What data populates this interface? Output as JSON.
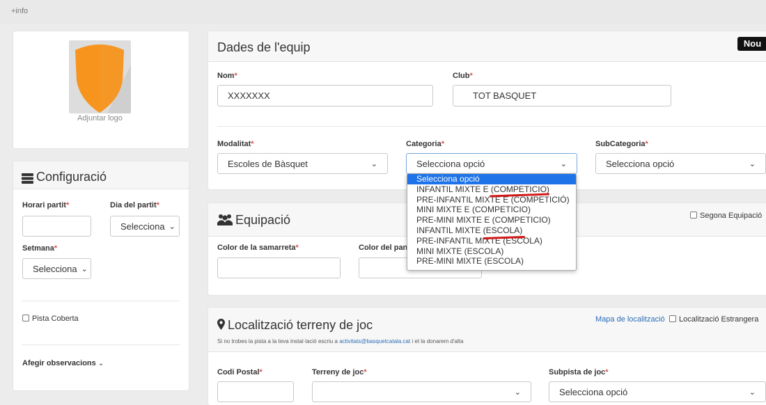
{
  "top": {
    "info_link": "+info"
  },
  "logo_card": {
    "upload_label": "Adjuntar logo"
  },
  "config": {
    "title": "Configuració",
    "horari_label": "Horari partit",
    "dia_label": "Dia del partit",
    "dia_select": "Selecciona",
    "setmana_label": "Setmana",
    "setmana_select": "Selecciona",
    "pista_coberta": "Pista Coberta",
    "observacions": "Afegir observacions",
    "required_mark": "*"
  },
  "team": {
    "title": "Dades de l'equip",
    "badge": "Nou",
    "nom_label": "Nom",
    "nom_value": "XXXXXXX",
    "club_label": "Club",
    "club_value": "TOT BASQUET",
    "modalitat_label": "Modalitat",
    "modalitat_value": "Escoles de Bàsquet",
    "categoria_label": "Categoria",
    "categoria_value": "Selecciona opció",
    "subcategoria_label": "SubCategoria",
    "subcategoria_value": "Selecciona opció"
  },
  "categoria_dropdown": {
    "options": [
      "Selecciona opció",
      "INFANTIL MIXTE E (COMPETICIO)",
      "PRE-INFANTIL MIXTE E (COMPETICIÓ)",
      "MINI MIXTE E (COMPETICIO)",
      "PRE-MINI MIXTE E (COMPETICIO)",
      "INFANTIL MIXTE (ESCOLA)",
      "PRE-INFANTIL MIXTE (ESCOLA)",
      "MINI MIXTE (ESCOLA)",
      "PRE-MINI MIXTE (ESCOLA)"
    ],
    "selected_index": 0
  },
  "equipacio": {
    "title": "Equipació",
    "segona": "Segona Equipació",
    "samarreta_label": "Color de la samarreta",
    "pantalo_label": "Color del pantaló"
  },
  "localitzacio": {
    "title": "Localització terreny de joc",
    "map_link": "Mapa de localització",
    "estrangera": "Localització Estrangera",
    "hint_before": "Si no trobes la pista a la teva instal·lació escriu a ",
    "hint_email": "activitats@basquetcatala.cat",
    "hint_after": " i et la donarem d'alta",
    "codi_postal_label": "Codi Postal",
    "terreny_label": "Terreny de joc",
    "subpista_label": "Subpista de joc",
    "subpista_value": "Selecciona opció"
  },
  "colors": {
    "accent": "#1e73e8",
    "required": "#d9534f",
    "annotation": "#d01818",
    "shield": "#f7941d",
    "link": "#2a6db5"
  }
}
